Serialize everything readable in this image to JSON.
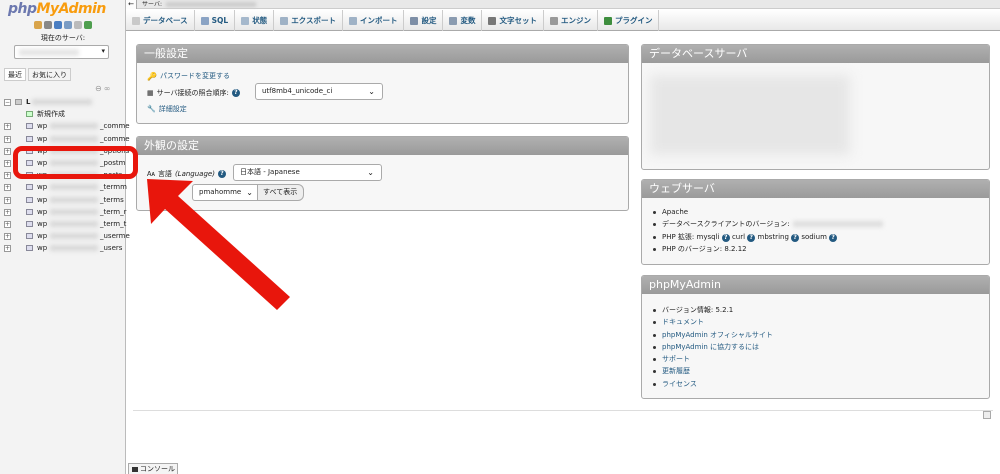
{
  "app": {
    "logo_part1": "php",
    "logo_part2": "MyAdmin"
  },
  "sidebar": {
    "current_server_label": "現在のサーバ:",
    "tabs": [
      "最近",
      "お気に入り"
    ],
    "root_db": "L",
    "new_label": "新規作成",
    "tables": [
      {
        "prefix": "wp",
        "suffix": "_comme"
      },
      {
        "prefix": "wp",
        "suffix": "_comme"
      },
      {
        "prefix": "wp",
        "suffix": "_options"
      },
      {
        "prefix": "wp",
        "suffix": "_postm"
      },
      {
        "prefix": "wp",
        "suffix": "_posts"
      },
      {
        "prefix": "wp",
        "suffix": "_termm"
      },
      {
        "prefix": "wp",
        "suffix": "_terms"
      },
      {
        "prefix": "wp",
        "suffix": "_term_r"
      },
      {
        "prefix": "wp",
        "suffix": "_term_t"
      },
      {
        "prefix": "wp",
        "suffix": "_userme"
      },
      {
        "prefix": "wp",
        "suffix": "_users"
      }
    ]
  },
  "topbar": {
    "server_label": "サーバ:"
  },
  "menu": [
    {
      "label": "データベース",
      "icon": "database-icon",
      "color": "#c9c9c9"
    },
    {
      "label": "SQL",
      "icon": "sql-icon",
      "color": "#8aa3c4"
    },
    {
      "label": "状態",
      "icon": "status-icon",
      "color": "#a5b8cc"
    },
    {
      "label": "エクスポート",
      "icon": "export-icon",
      "color": "#9fb2c6"
    },
    {
      "label": "インポート",
      "icon": "import-icon",
      "color": "#9fb2c6"
    },
    {
      "label": "設定",
      "icon": "wrench-icon",
      "color": "#7d8ea6"
    },
    {
      "label": "変数",
      "icon": "variables-icon",
      "color": "#8a9bb0"
    },
    {
      "label": "文字セット",
      "icon": "charset-icon",
      "color": "#777777"
    },
    {
      "label": "エンジン",
      "icon": "engine-icon",
      "color": "#999999"
    },
    {
      "label": "プラグイン",
      "icon": "plugin-icon",
      "color": "#3e8e3e"
    }
  ],
  "general": {
    "title": "一般設定",
    "change_password": "パスワードを変更する",
    "collation_label": "サーバ接続の照合順序:",
    "collation_value": "utf8mb4_unicode_ci",
    "more_settings": "詳細設定"
  },
  "appearance": {
    "title": "外観の設定",
    "language_label": "言語",
    "language_en": "(Language)",
    "language_value": "日本語 - Japanese",
    "theme_value": "pmahomme",
    "view_all": "すべて表示"
  },
  "db_server": {
    "title": "データベースサーバ"
  },
  "web_server": {
    "title": "ウェブサーバ",
    "items": [
      "Apache",
      "データベースクライアントのバージョン:"
    ],
    "php_ext_label": "PHP 拡張:",
    "php_exts": [
      "mysqli",
      "curl",
      "mbstring",
      "sodium"
    ],
    "php_version": "PHP のバージョン: 8.2.12"
  },
  "pma": {
    "title": "phpMyAdmin",
    "version": "バージョン情報: 5.2.1",
    "links": [
      "ドキュメント",
      "phpMyAdmin オフィシャルサイト",
      "phpMyAdmin に協力するには",
      "サポート",
      "更新履歴",
      "ライセンス"
    ]
  },
  "console": {
    "label": "コンソール"
  },
  "colors": {
    "highlight": "#e8160c",
    "link": "#235a81",
    "panel_header": "#a5a5a5"
  }
}
